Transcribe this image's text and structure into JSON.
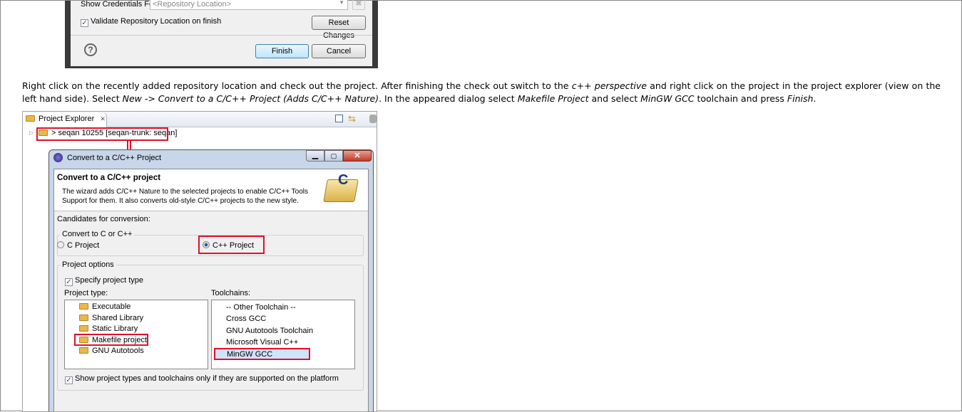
{
  "shot1": {
    "credentials_label": "Show Credentials For:",
    "credentials_value": "<Repository Location>",
    "validate_label": "Validate Repository Location on finish",
    "reset_button": "Reset Changes",
    "help_icon": "?",
    "finish_button": "Finish",
    "cancel_button": "Cancel"
  },
  "paragraph": {
    "p1": "Right click on the recently added repository location and check out the project. After finishing the check out switch to the ",
    "p2": "c++ perspective",
    "p3": " and right click on the project in the project explorer (view on the left hand side). Select ",
    "p4": "New -> Convert to a C/C++ Project (Adds C/C++ Nature)",
    "p5": ". In the appeared dialog select ",
    "p6": "Makefile Project",
    "p7": " and select ",
    "p8": "MinGW GCC",
    "p9": " toolchain and press ",
    "p10": "Finish",
    "p11": "."
  },
  "shot2": {
    "explorer_tab": "Project Explorer",
    "tab_close": "✕",
    "project_node": "> seqan 10255 [seqan-trunk: seqan]",
    "dialog_title": "Convert to a C/C++ Project",
    "header_title": "Convert to a C/C++ project",
    "header_desc1": "The wizard adds C/C++ Nature to the selected projects to enable C/C++ Tools",
    "header_desc2": "Support for them. It also converts old-style C/C++ projects to the new style.",
    "candidates_label": "Candidates for conversion:",
    "convert_group": "Convert to C or C++",
    "radio_c": "C Project",
    "radio_cpp": "C++ Project",
    "options_group": "Project options",
    "specify_type": "Specify project type",
    "project_type_label": "Project type:",
    "toolchains_label": "Toolchains:",
    "project_types": [
      "Executable",
      "Shared Library",
      "Static Library",
      "Makefile project",
      "GNU Autotools"
    ],
    "toolchains": [
      "-- Other Toolchain --",
      "Cross GCC",
      "GNU Autotools Toolchain",
      "Microsoft Visual C++",
      "MinGW GCC"
    ],
    "show_supported": "Show project types and toolchains only if they are supported on the platform"
  },
  "colors": {
    "highlight": "#e0102a",
    "selection": "#cfe3fb"
  }
}
